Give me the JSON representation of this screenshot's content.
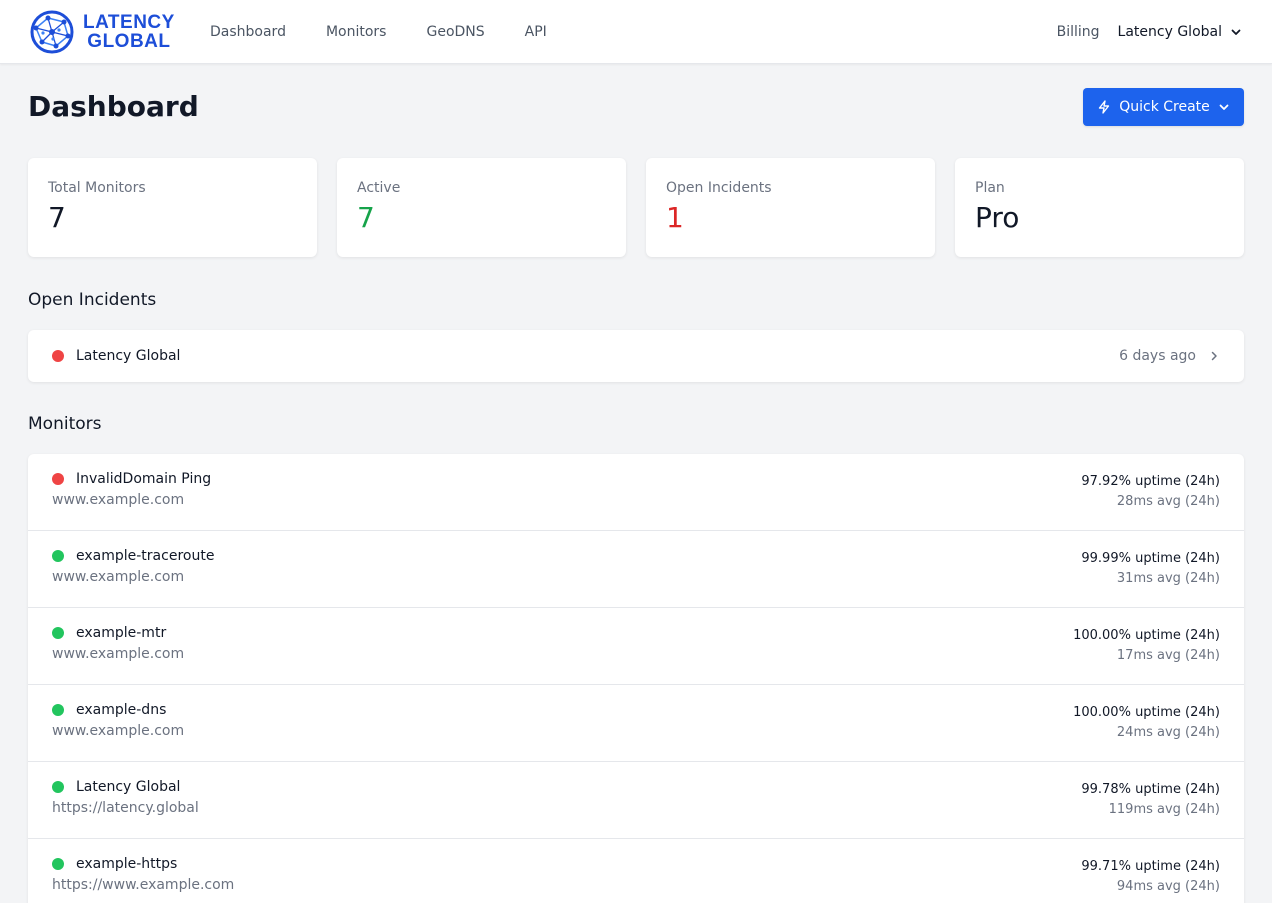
{
  "brand": {
    "line1": "LATENCY",
    "line2": "GLOBAL"
  },
  "nav": {
    "items": [
      "Dashboard",
      "Monitors",
      "GeoDNS",
      "API"
    ]
  },
  "account": {
    "billing": "Billing",
    "org": "Latency Global"
  },
  "page": {
    "title": "Dashboard",
    "quick_create": "Quick Create"
  },
  "stats": [
    {
      "label": "Total Monitors",
      "value": "7",
      "color": "#111827"
    },
    {
      "label": "Active",
      "value": "7",
      "color": "#16a34a"
    },
    {
      "label": "Open Incidents",
      "value": "1",
      "color": "#dc2626"
    },
    {
      "label": "Plan",
      "value": "Pro",
      "color": "#111827"
    }
  ],
  "incidents": {
    "title": "Open Incidents",
    "items": [
      {
        "name": "Latency Global",
        "time": "6 days ago",
        "status": "down"
      }
    ]
  },
  "monitors": {
    "title": "Monitors",
    "items": [
      {
        "name": "InvalidDomain Ping",
        "url": "www.example.com",
        "uptime": "97.92% uptime (24h)",
        "avg": "28ms avg (24h)",
        "status": "down"
      },
      {
        "name": "example-traceroute",
        "url": "www.example.com",
        "uptime": "99.99% uptime (24h)",
        "avg": "31ms avg (24h)",
        "status": "up"
      },
      {
        "name": "example-mtr",
        "url": "www.example.com",
        "uptime": "100.00% uptime (24h)",
        "avg": "17ms avg (24h)",
        "status": "up"
      },
      {
        "name": "example-dns",
        "url": "www.example.com",
        "uptime": "100.00% uptime (24h)",
        "avg": "24ms avg (24h)",
        "status": "up"
      },
      {
        "name": "Latency Global",
        "url": "https://latency.global",
        "uptime": "99.78% uptime (24h)",
        "avg": "119ms avg (24h)",
        "status": "up"
      },
      {
        "name": "example-https",
        "url": "https://www.example.com",
        "uptime": "99.71% uptime (24h)",
        "avg": "94ms avg (24h)",
        "status": "up"
      }
    ]
  },
  "colors": {
    "accent": "#1d63ed",
    "status_up": "#22c55e",
    "status_down": "#ef4444"
  }
}
